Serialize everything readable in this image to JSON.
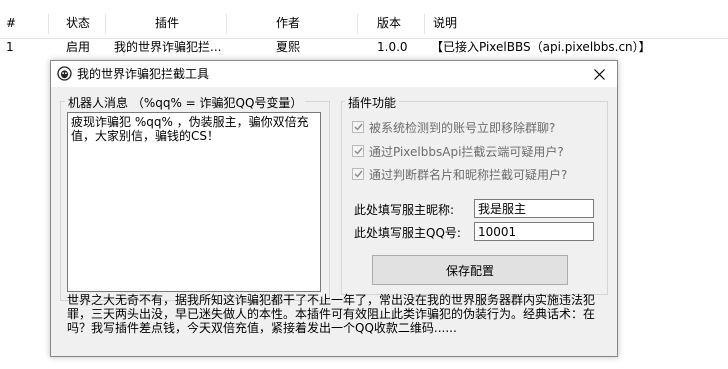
{
  "list": {
    "headers": {
      "index": "#",
      "status": "状态",
      "plugin": "插件",
      "author": "作者",
      "version": "版本",
      "desc": "说明"
    },
    "row": {
      "index": "1",
      "status": "启用",
      "plugin": "我的世界诈骗犯拦...",
      "author": "夏熙",
      "version": "1.0.0",
      "desc": "【已接入PixelBBS（api.pixelbbs.cn）】"
    }
  },
  "dialog": {
    "title": "我的世界诈骗犯拦截工具",
    "close_icon": "close-icon",
    "message_group_label": "机器人消息 （%qq% = 诈骗犯QQ号变量）",
    "message_text": "疲现诈骗犯 %qq% ，伪装服主，骗你双倍充值，大家别信，骗钱的CS！",
    "function_group_label": "插件功能",
    "checkboxes": [
      {
        "label": "被系统检测到的账号立即移除群聊?",
        "checked": true
      },
      {
        "label": "通过PixelbbsApi拦截云端可疑用户?",
        "checked": true
      },
      {
        "label": "通过判断群名片和昵称拦截可疑用户?",
        "checked": true
      }
    ],
    "owner_nick_label": "此处填写服主昵称:",
    "owner_nick_value": "我是服主",
    "owner_qq_label": "此处填写服主QQ号:",
    "owner_qq_value": "10001",
    "save_label": "保存配置",
    "footer": "世界之大无奇不有，据我所知这诈骗犯都干了不止一年了，常出没在我的世界服务器群内实施违法犯罪，三天两头出没，早已迷失做人的本性。本插件可有效阻止此类诈骗犯的伪装行为。经典话术：在吗？我写插件差点钱，今天双倍充值，紧接着发出一个QQ收款二维码......"
  }
}
